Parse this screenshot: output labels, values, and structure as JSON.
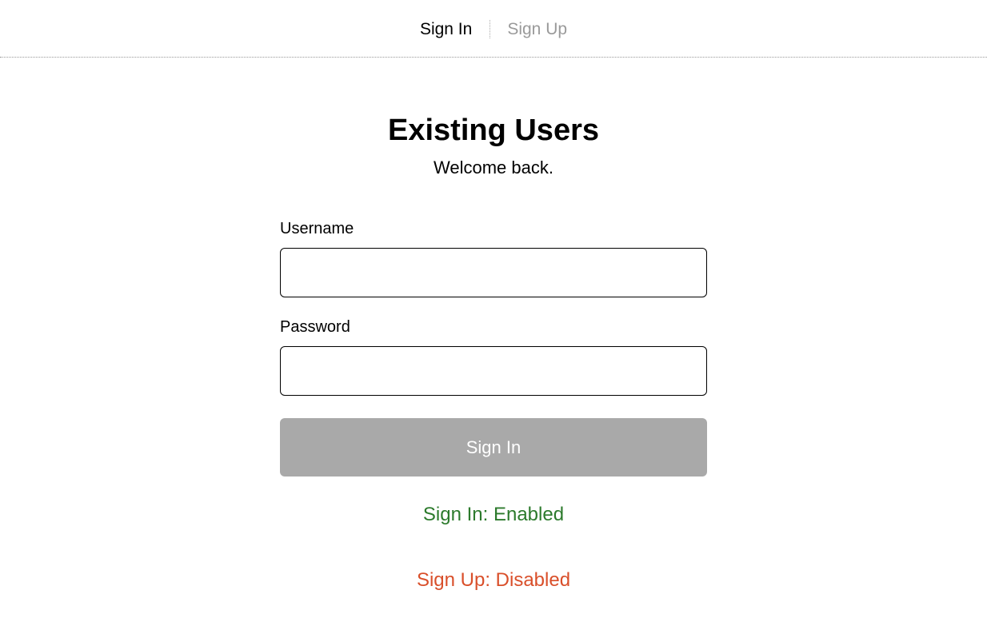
{
  "tabs": {
    "signin": "Sign In",
    "signup": "Sign Up"
  },
  "heading": "Existing Users",
  "subheading": "Welcome back.",
  "form": {
    "username_label": "Username",
    "username_value": "",
    "password_label": "Password",
    "password_value": "",
    "submit_label": "Sign In"
  },
  "status": {
    "signin": "Sign In: Enabled",
    "signup": "Sign Up: Disabled"
  }
}
